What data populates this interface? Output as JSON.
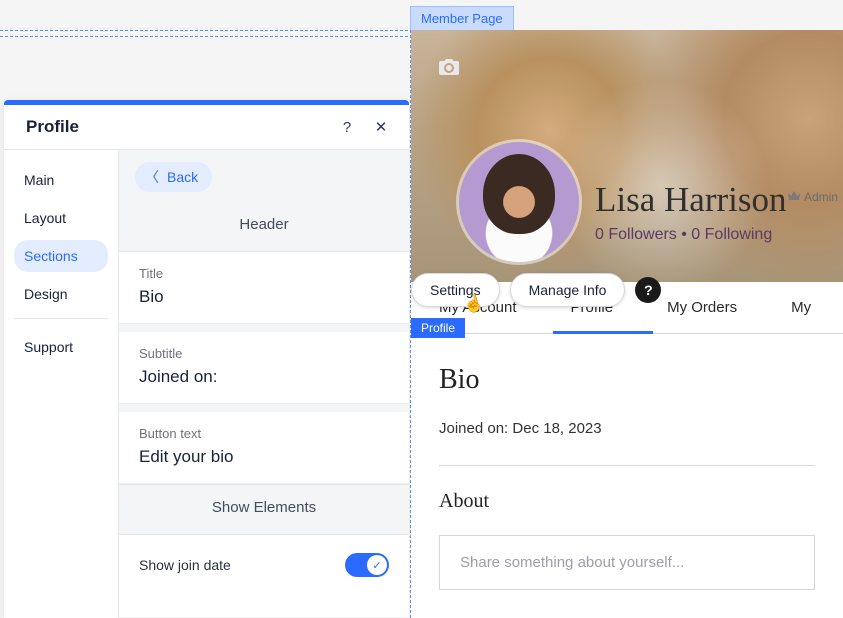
{
  "editor": {
    "member_page_tag": "Member Page",
    "profile_tag": "Profile"
  },
  "panel": {
    "title": "Profile",
    "nav": {
      "main": "Main",
      "layout": "Layout",
      "sections": "Sections",
      "design": "Design",
      "support": "Support"
    },
    "back": "Back",
    "section_heading": "Header",
    "fields": {
      "title_label": "Title",
      "title_value": "Bio",
      "subtitle_label": "Subtitle",
      "subtitle_value": "Joined on:",
      "button_label": "Button text",
      "button_value": "Edit your bio"
    },
    "show_elements_heading": "Show Elements",
    "toggle": {
      "join_date_label": "Show join date",
      "join_date_on": true
    }
  },
  "controls": {
    "settings": "Settings",
    "manage_info": "Manage Info",
    "help": "?"
  },
  "profile": {
    "name": "Lisa Harrison",
    "admin_label": "Admin",
    "follow_line": "0 Followers • 0 Following",
    "tabs": {
      "my_account": "My Account",
      "profile": "Profile",
      "my_orders": "My Orders",
      "my_other": "My"
    },
    "bio_heading": "Bio",
    "joined_line": "Joined on: Dec 18, 2023",
    "about_heading": "About",
    "about_placeholder": "Share something about yourself..."
  }
}
